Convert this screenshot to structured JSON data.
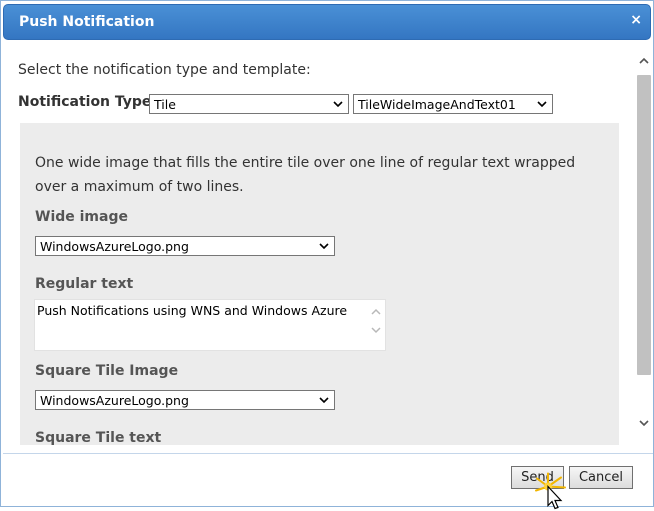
{
  "dialog": {
    "title": "Push Notification",
    "close_glyph": "×"
  },
  "content": {
    "intro": "Select the notification type and template:",
    "notification_type_label": "Notification Type:",
    "type_select": {
      "value": "Tile"
    },
    "template_select": {
      "value": "TileWideImageAndText01"
    },
    "description": "One wide image that fills the entire tile over one line of regular text wrapped over a maximum of two lines.",
    "fields": {
      "wide_image": {
        "label": "Wide image",
        "value": "WindowsAzureLogo.png"
      },
      "regular_text": {
        "label": "Regular text",
        "value": "Push Notifications using WNS and Windows Azure"
      },
      "square_tile_image": {
        "label": "Square Tile Image",
        "value": "WindowsAzureLogo.png"
      },
      "square_tile_text": {
        "label": "Square Tile text"
      }
    }
  },
  "buttons": {
    "send": "Send",
    "cancel": "Cancel"
  },
  "icons": [
    "close-icon",
    "chevron-down-icon",
    "scroll-up-icon",
    "scroll-down-icon",
    "mouse-cursor-icon"
  ],
  "colors": {
    "titlebar": "#3a80cc",
    "panel": "#ececec",
    "label_text": "#555555"
  }
}
